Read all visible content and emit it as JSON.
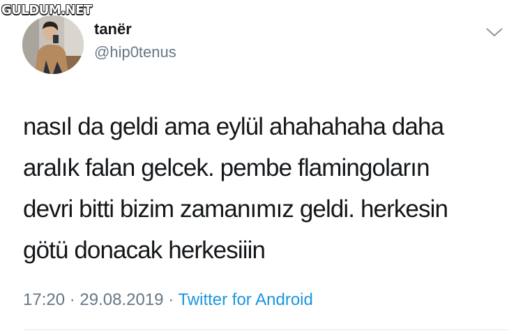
{
  "watermark": {
    "text": "GULDUM.NET"
  },
  "tweet": {
    "author": {
      "display_name": "tanër",
      "handle": "@hip0tenus"
    },
    "text_lines": [
      "nasıl da geldi ama eylül ahahahaha daha",
      "aralık falan gelcek. pembe flamingoların",
      "devri bitti bizim zamanımız geldi. herkesin",
      "götü donacak herkesiiin"
    ],
    "time": "17:20",
    "separator": "·",
    "date": "29.08.2019",
    "source": "Twitter for Android"
  },
  "icons": {
    "menu": "chevron-down-icon",
    "avatar": "profile-photo"
  },
  "colors": {
    "text": "#14171a",
    "secondary": "#657786",
    "link": "#1b95e0",
    "divider": "#e1e8ed"
  }
}
